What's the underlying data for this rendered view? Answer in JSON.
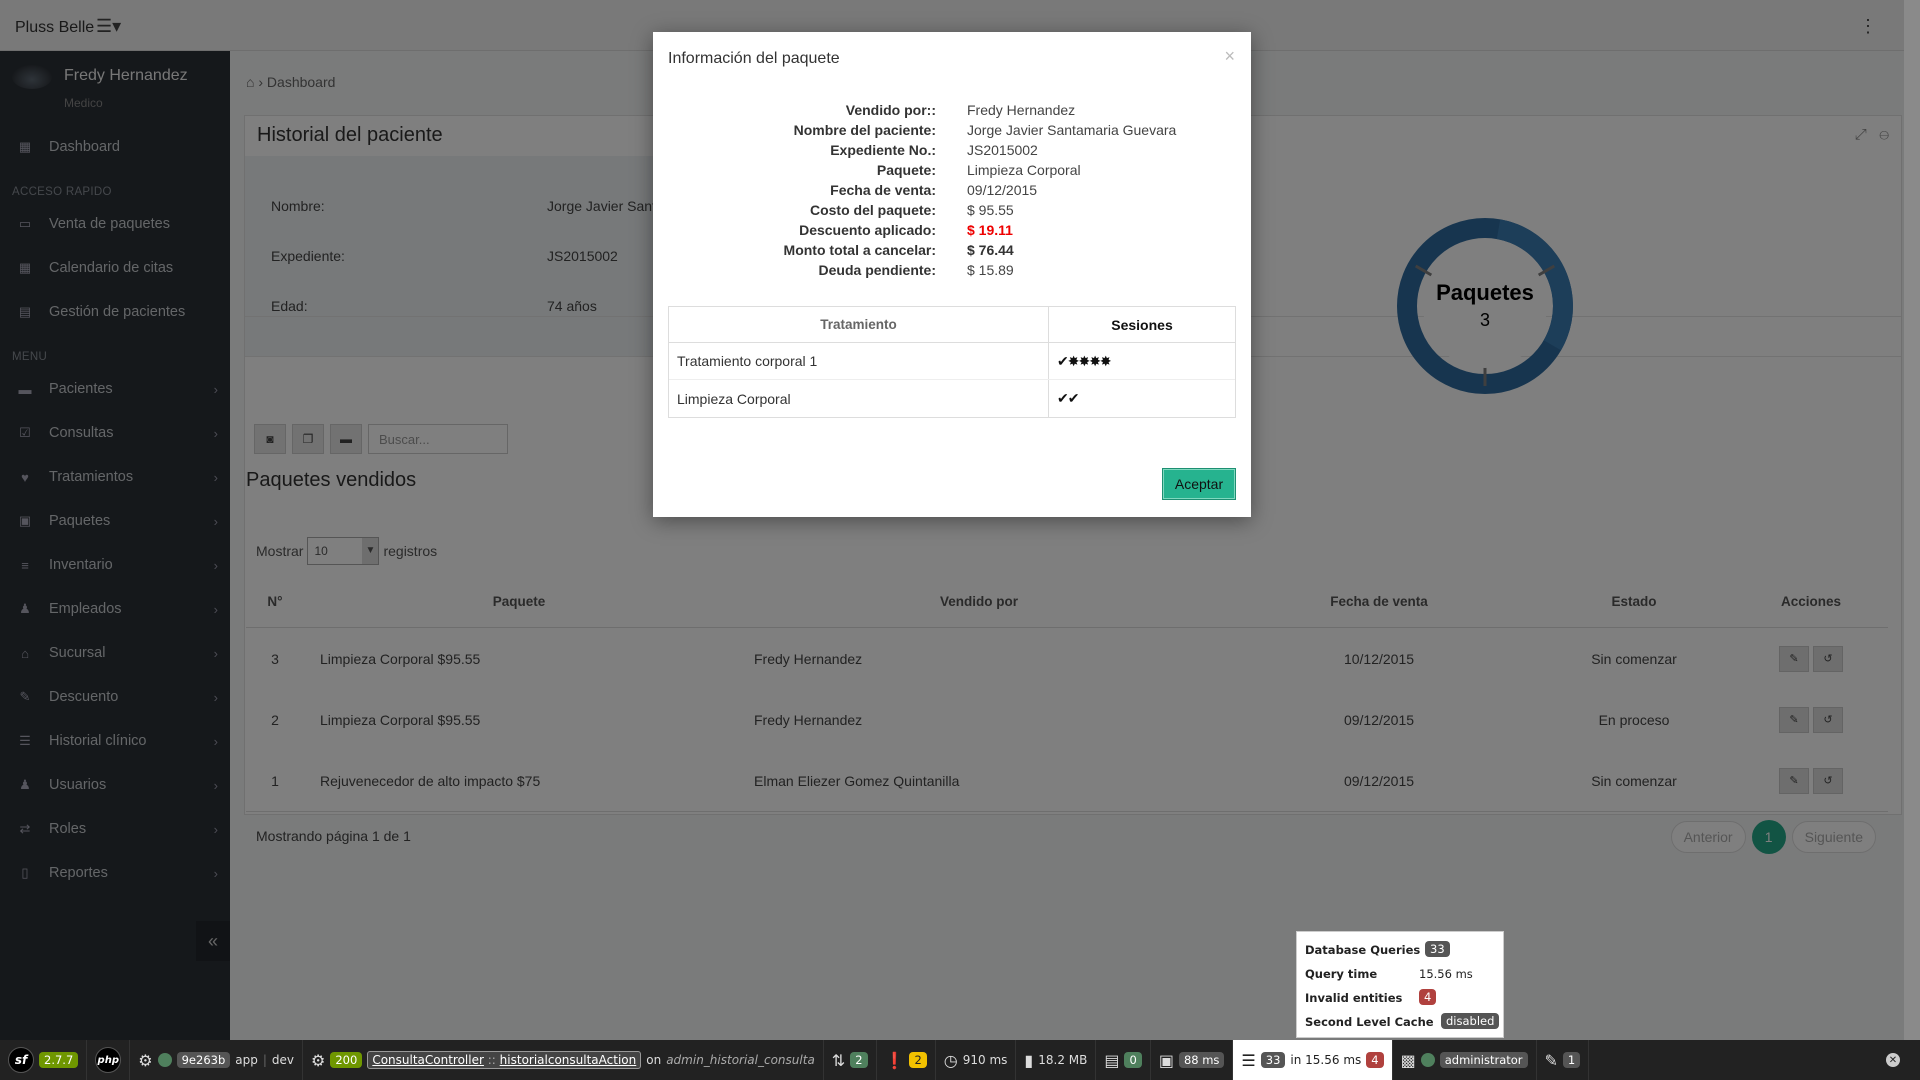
{
  "app": {
    "brand": "Pluss Belle",
    "menu_toggle": "☰▾",
    "kebab": "⋮"
  },
  "sidebar": {
    "user_name": "Fredy Hernandez",
    "user_role": "Medico",
    "dashboard": "Dashboard",
    "quick_access_head": "ACCESO RAPIDO",
    "quick_access": [
      {
        "label": "Venta de paquetes",
        "icon": "cash-icon"
      },
      {
        "label": "Calendario de citas",
        "icon": "calendar-icon"
      },
      {
        "label": "Gestión de pacientes",
        "icon": "clipboard-icon"
      }
    ],
    "menu_head": "MENU",
    "menu": [
      {
        "label": "Pacientes",
        "icon": "bed-icon"
      },
      {
        "label": "Consultas",
        "icon": "check-square-icon"
      },
      {
        "label": "Tratamientos",
        "icon": "heartbeat-icon"
      },
      {
        "label": "Paquetes",
        "icon": "briefcase-icon"
      },
      {
        "label": "Inventario",
        "icon": "database-icon"
      },
      {
        "label": "Empleados",
        "icon": "users-icon"
      },
      {
        "label": "Sucursal",
        "icon": "bank-icon"
      },
      {
        "label": "Descuento",
        "icon": "magic-icon"
      },
      {
        "label": "Historial clínico",
        "icon": "list-icon"
      },
      {
        "label": "Usuarios",
        "icon": "users-icon"
      },
      {
        "label": "Roles",
        "icon": "exchange-icon"
      },
      {
        "label": "Reportes",
        "icon": "file-icon"
      }
    ],
    "collapse": "«"
  },
  "breadcrumb": {
    "current": "Dashboard"
  },
  "patient_panel": {
    "title": "Historial del paciente",
    "rows": [
      {
        "label": "Nombre:",
        "value": "Jorge Javier Santar"
      },
      {
        "label": "Expediente:",
        "value": "JS2015002"
      },
      {
        "label": "Edad:",
        "value": "74 años"
      }
    ],
    "donut_label": "Paquetes",
    "donut_count": "3"
  },
  "packages": {
    "search_placeholder": "Buscar...",
    "title": "Paquetes vendidos",
    "show_label": "Mostrar",
    "show_value": "10",
    "records_label": "registros",
    "columns": [
      "N°",
      "Paquete",
      "Vendido por",
      "Fecha de venta",
      "Estado",
      "Acciones"
    ],
    "rows": [
      {
        "n": "3",
        "paquete": "Limpieza Corporal $95.55",
        "vendido": "Fredy Hernandez",
        "fecha": "10/12/2015",
        "estado": "Sin comenzar"
      },
      {
        "n": "2",
        "paquete": "Limpieza Corporal $95.55",
        "vendido": "Fredy Hernandez",
        "fecha": "09/12/2015",
        "estado": "En proceso"
      },
      {
        "n": "1",
        "paquete": "Rejuvenecedor de alto impacto $75",
        "vendido": "Elman Eliezer Gomez Quintanilla",
        "fecha": "09/12/2015",
        "estado": "Sin comenzar"
      }
    ],
    "page_info": "Mostrando página 1 de 1",
    "prev": "Anterior",
    "current_page": "1",
    "next": "Siguiente"
  },
  "modal": {
    "title": "Información del paquete",
    "close": "×",
    "details": [
      {
        "label": "Vendido por::",
        "value": "Fredy Hernandez",
        "style": ""
      },
      {
        "label": "Nombre del paciente:",
        "value": "Jorge Javier Santamaria Guevara",
        "style": ""
      },
      {
        "label": "Expediente No.:",
        "value": "JS2015002",
        "style": ""
      },
      {
        "label": "Paquete:",
        "value": "Limpieza Corporal",
        "style": ""
      },
      {
        "label": "Fecha de venta:",
        "value": "09/12/2015",
        "style": ""
      },
      {
        "label": "Costo del paquete:",
        "value": "$ 95.55",
        "style": ""
      },
      {
        "label": "Descuento aplicado:",
        "value": "$ 19.11",
        "style": "red"
      },
      {
        "label": "Monto total a cancelar:",
        "value": "$ 76.44",
        "style": "bold"
      },
      {
        "label": "Deuda pendiente:",
        "value": "$ 15.89",
        "style": ""
      }
    ],
    "table_headers": [
      "Tratamiento",
      "Sesiones"
    ],
    "table_rows": [
      {
        "tratamiento": "Tratamiento corporal 1",
        "sesiones": "✔✸✸✸✸"
      },
      {
        "tratamiento": "Limpieza Corporal",
        "sesiones": "✔✔"
      }
    ],
    "accept": "Aceptar"
  },
  "symfony": {
    "version": "2.7.7",
    "token": "9e263b",
    "app_label": "app",
    "env": "dev",
    "status": "200",
    "controller": "ConsultaController",
    "sep": "::",
    "action": "historialconsultaAction",
    "on": "on",
    "route": "admin_historial_consulta",
    "ajax": "2",
    "warnings": "2",
    "time": "910 ms",
    "memory": "18.2 MB",
    "forms": "0",
    "twig": "88 ms",
    "queries": "33",
    "query_in": "in 15.56 ms",
    "invalid": "4",
    "user": "administrator",
    "translation": "1",
    "tooltip": {
      "db_queries_label": "Database Queries",
      "db_queries": "33",
      "query_time_label": "Query time",
      "query_time": "15.56 ms",
      "invalid_label": "Invalid entities",
      "invalid": "4",
      "cache_label": "Second Level Cache",
      "cache": "disabled"
    }
  }
}
